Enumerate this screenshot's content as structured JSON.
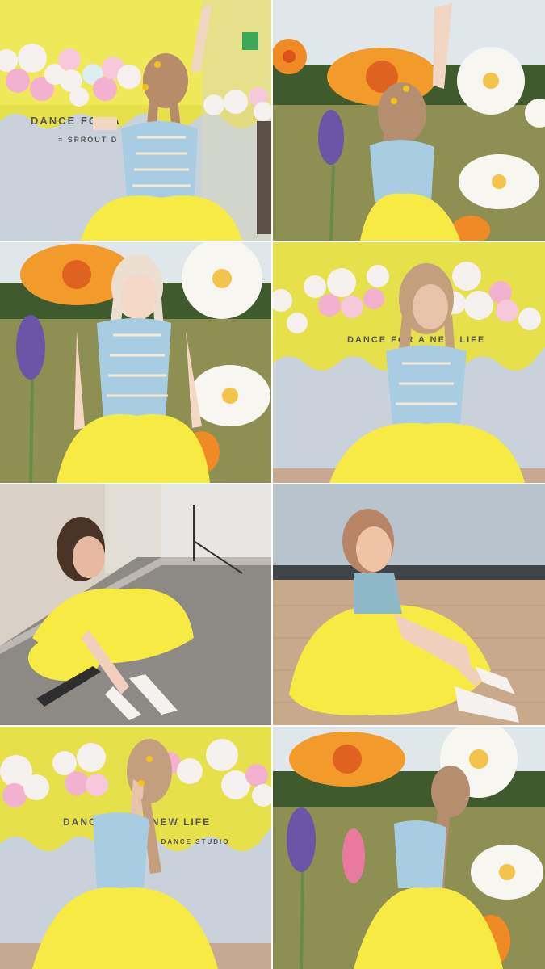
{
  "layout": {
    "columns": 2,
    "rows": 4
  },
  "photos": [
    {
      "scene": "studio wall with balloon garland",
      "wall_text": "DANCE FOR A",
      "sub_text": "SPROUT D"
    },
    {
      "scene": "garden with giant paper flowers"
    },
    {
      "scene": "garden with giant paper flowers, front view"
    },
    {
      "scene": "studio wall with balloon garland",
      "wall_text": "DANCE FOR A NEW LIFE"
    },
    {
      "scene": "seated on skateboard in white room"
    },
    {
      "scene": "seated on floor in studio"
    },
    {
      "scene": "studio wall with balloon garland, side view",
      "wall_text": "DANCE FOR A NEW LIFE",
      "sub_text": "SPROUT DANCE STUDIO"
    },
    {
      "scene": "garden with giant paper flowers, side view"
    }
  ],
  "colors": {
    "wall_yellow": "#e9e34f",
    "tulle_yellow": "#f6ea43",
    "corset_blue": "#a8cde3",
    "grass_green": "#7d8a3c",
    "sky": "#dfe7ea",
    "balloon_pink": "#f2b2cf",
    "balloon_white": "#f4f1ee",
    "flower_orange": "#f08a25",
    "flower_white": "#f8f6f0",
    "flower_purple": "#6a55a6"
  }
}
